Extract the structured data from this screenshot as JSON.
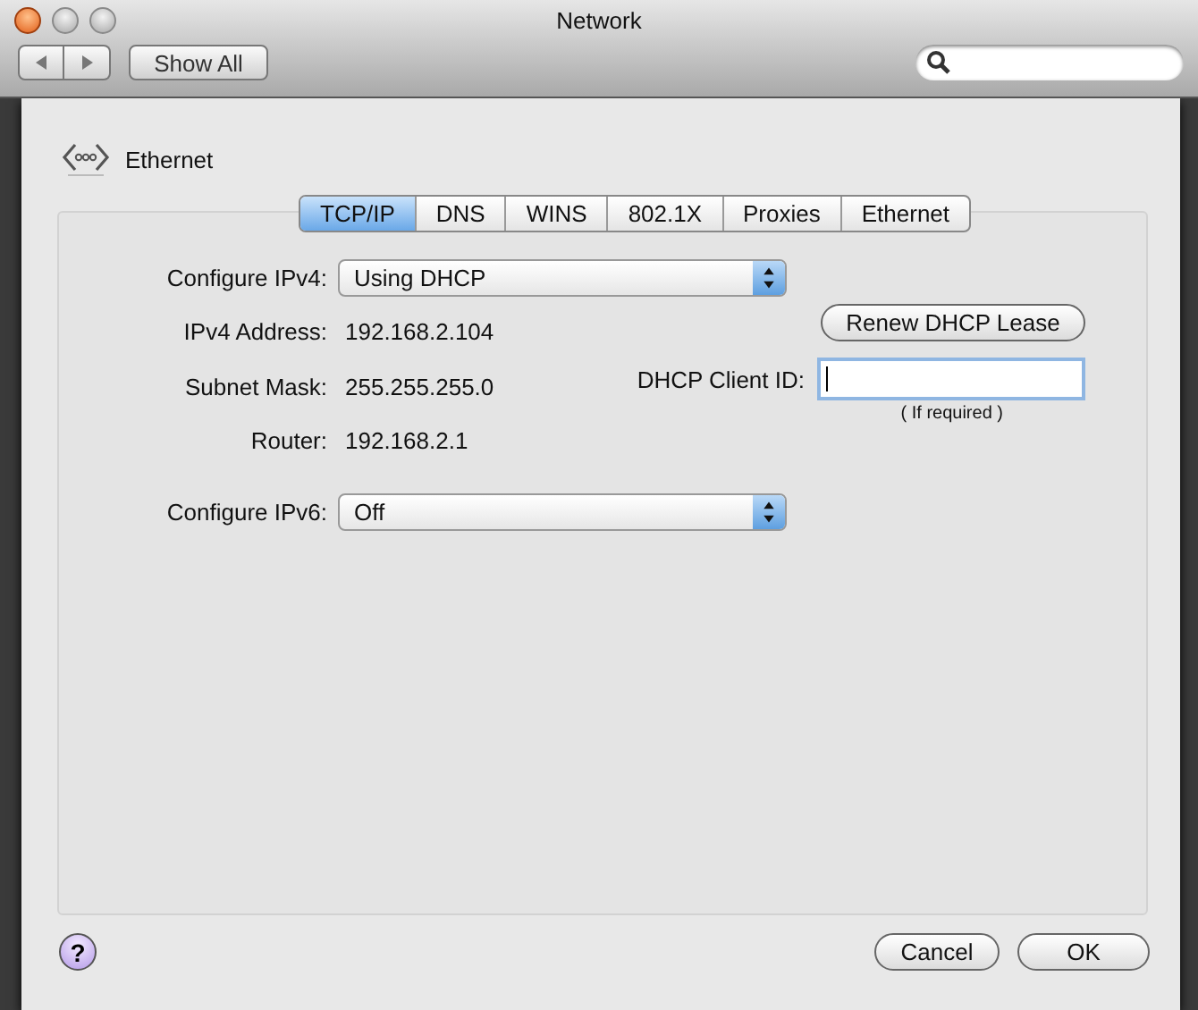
{
  "window": {
    "title": "Network"
  },
  "toolbar": {
    "show_all": "Show All"
  },
  "sheet": {
    "service": "Ethernet",
    "tabs": [
      {
        "label": "TCP/IP",
        "selected": true
      },
      {
        "label": "DNS",
        "selected": false
      },
      {
        "label": "WINS",
        "selected": false
      },
      {
        "label": "802.1X",
        "selected": false
      },
      {
        "label": "Proxies",
        "selected": false
      },
      {
        "label": "Ethernet",
        "selected": false
      }
    ],
    "configure_ipv4": {
      "label": "Configure IPv4:",
      "value": "Using DHCP"
    },
    "fields": [
      {
        "label": "IPv4 Address:",
        "value": "192.168.2.104"
      },
      {
        "label": "Subnet Mask:",
        "value": "255.255.255.0"
      },
      {
        "label": "Router:",
        "value": "192.168.2.1"
      }
    ],
    "renew_button": "Renew DHCP Lease",
    "client_id": {
      "label": "DHCP Client ID:",
      "hint": "( If required )"
    },
    "configure_ipv6": {
      "label": "Configure IPv6:",
      "value": "Off"
    },
    "help": "?",
    "buttons": [
      "Cancel",
      "OK"
    ]
  }
}
